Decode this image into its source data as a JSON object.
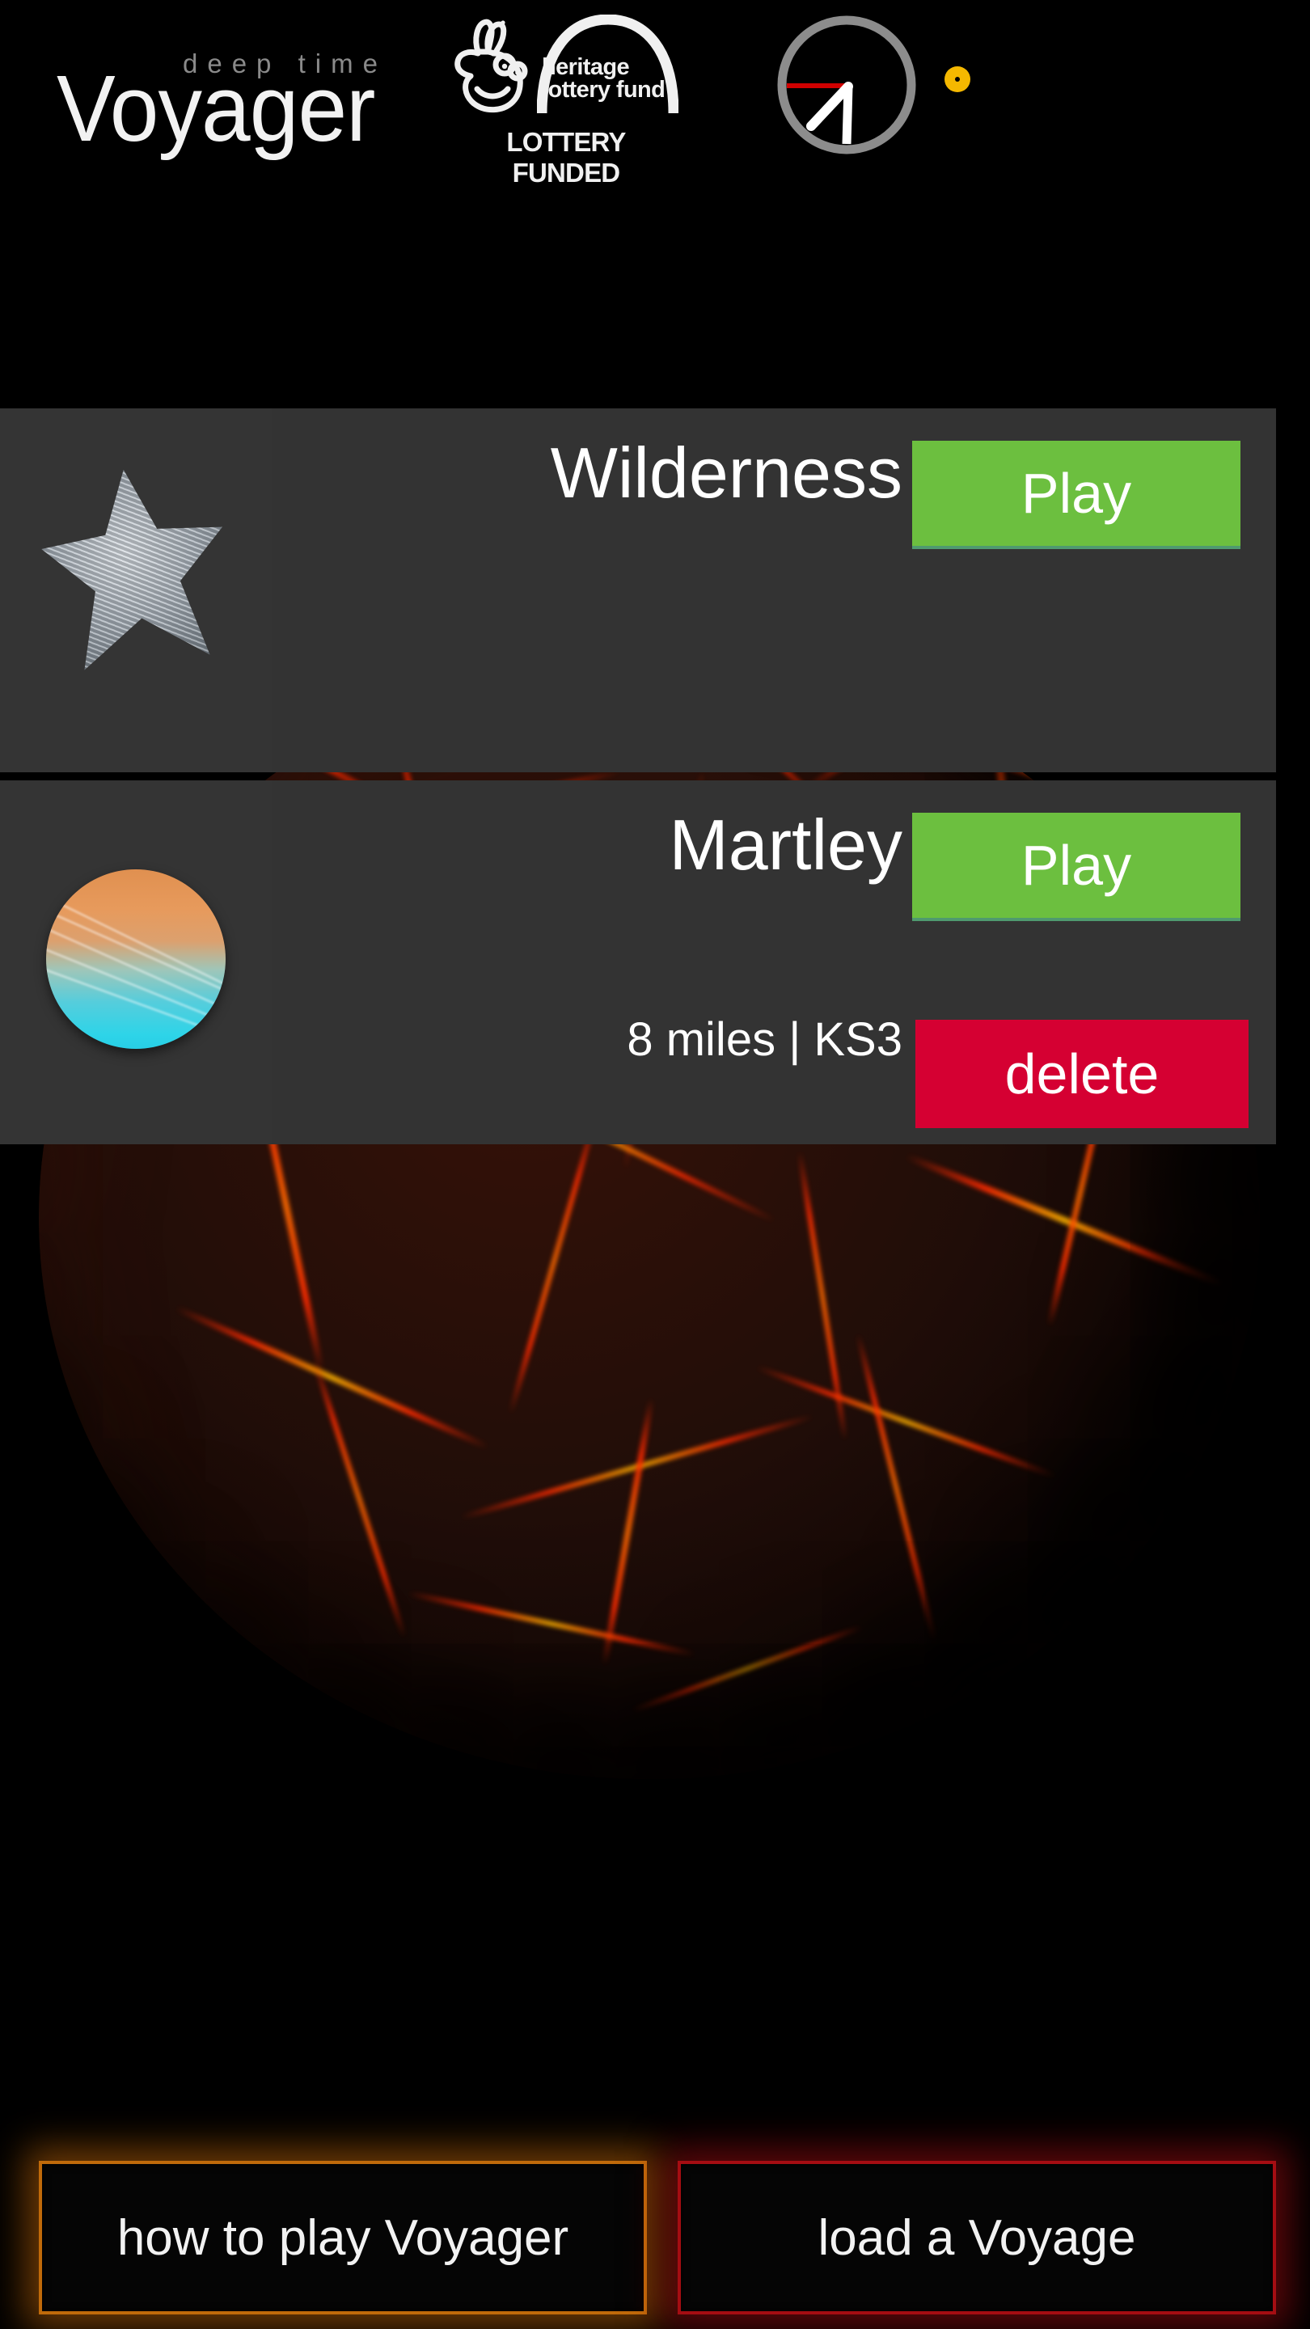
{
  "app": {
    "brand_kicker": "deep time",
    "brand_name": "Voyager",
    "funder": {
      "line1": "heritage",
      "line2": "lottery fund",
      "badge": "LOTTERY FUNDED"
    },
    "status_dot_color": "#f5b800",
    "clock_hand_color": "#ffffff",
    "clock_marker_color": "#d00000"
  },
  "voyages": [
    {
      "title": "Wilderness",
      "subtitle": "",
      "thumbnail": "starfish-fossil-thumbnail",
      "play_label": "Play",
      "delete_label": "",
      "has_delete": false
    },
    {
      "title": "Martley",
      "subtitle": "8 miles | KS3",
      "thumbnail": "globe-thumbnail",
      "play_label": "Play",
      "delete_label": "delete",
      "has_delete": true
    }
  ],
  "colors": {
    "play_button": "#6cbf3f",
    "delete_button": "#d50032",
    "row_background": "#333333",
    "howto_glow": "#c06a0a",
    "load_glow": "#a50d12"
  },
  "footer": {
    "howto_label": "how to play Voyager",
    "load_label": "load a Voyage"
  }
}
